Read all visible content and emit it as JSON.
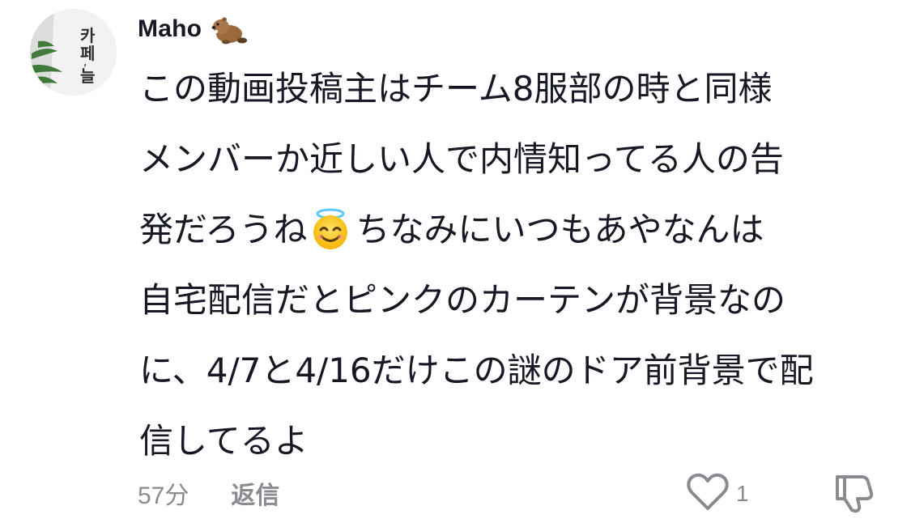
{
  "comment": {
    "author": "Maho",
    "author_emoji": "beaver-icon",
    "avatar_icon": "cafe-sign-avatar",
    "lines": [
      "この動画投稿主はチーム8服部の時と同様",
      "メンバーか近しい人で内情知ってる人の告",
      "ちなみにいつもあやなんは",
      "自宅配信だとピンクのカーテンが背景なの",
      "に、4/7と4/16だけこの謎のドア前背景で配",
      "信してるよ"
    ],
    "line3_prefix": "発だろうね",
    "inline_emoji": "smiling-face-with-halo-icon",
    "time": "57分",
    "reply_label": "返信",
    "like_count": "1"
  },
  "colors": {
    "text": "#161823",
    "muted": "#8a8b91",
    "background": "#ffffff"
  }
}
